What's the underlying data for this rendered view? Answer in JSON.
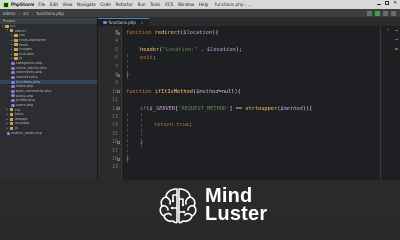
{
  "menubar": {
    "app_name": "PhpStorm",
    "items": [
      "File",
      "Edit",
      "View",
      "Navigate",
      "Code",
      "Refactor",
      "Run",
      "Tools",
      "VCS",
      "Window",
      "Help"
    ],
    "document_title": "functions.php - ..."
  },
  "toolbar": {
    "breadcrumbs": [
      "admin",
      "src",
      "functions.php"
    ]
  },
  "project": {
    "header": "Project",
    "tree": [
      {
        "label": "src",
        "kind": "folder",
        "depth": 0,
        "arrow": "▾"
      },
      {
        "label": "admin",
        "kind": "folder",
        "depth": 1,
        "arrow": "▾"
      },
      {
        "label": "css",
        "kind": "folder",
        "depth": 2,
        "arrow": "▸"
      },
      {
        "label": "fonts-awesome",
        "kind": "folder",
        "depth": 2,
        "arrow": "▸"
      },
      {
        "label": "fonts",
        "kind": "folder",
        "depth": 2,
        "arrow": "▸"
      },
      {
        "label": "images",
        "kind": "folder",
        "depth": 2,
        "arrow": "▸"
      },
      {
        "label": "includes",
        "kind": "folder",
        "depth": 2,
        "arrow": "▸"
      },
      {
        "label": "js",
        "kind": "folder",
        "depth": 2,
        "arrow": "▸"
      },
      {
        "label": "categories.php",
        "kind": "php",
        "depth": 2
      },
      {
        "label": "check_admin.php",
        "kind": "php",
        "depth": 2
      },
      {
        "label": "comments.php",
        "kind": "php",
        "depth": 2
      },
      {
        "label": "connect.php",
        "kind": "php",
        "depth": 2
      },
      {
        "label": "functions.php",
        "kind": "php",
        "depth": 2
      },
      {
        "label": "index.php",
        "kind": "php",
        "depth": 2
      },
      {
        "label": "post_comments.php",
        "kind": "php",
        "depth": 2
      },
      {
        "label": "posts.php",
        "kind": "php",
        "depth": 2
      },
      {
        "label": "profile.php",
        "kind": "php",
        "depth": 2
      },
      {
        "label": "users.php",
        "kind": "php",
        "depth": 2
      },
      {
        "label": "css",
        "kind": "folder",
        "depth": 1,
        "arrow": "▸"
      },
      {
        "label": "fonts",
        "kind": "folder",
        "depth": 1,
        "arrow": "▸"
      },
      {
        "label": "images",
        "kind": "folder",
        "depth": 1,
        "arrow": "▸"
      },
      {
        "label": "includes",
        "kind": "folder",
        "depth": 1,
        "arrow": "▸"
      },
      {
        "label": "js",
        "kind": "folder",
        "depth": 1,
        "arrow": "▸"
      },
      {
        "label": "author_posts.php",
        "kind": "php",
        "depth": 1
      }
    ]
  },
  "editor": {
    "tab_label": "functions.php",
    "lines": [
      {
        "n": "3",
        "segments": [
          [
            "kw",
            "function "
          ],
          [
            "fn",
            "redirect"
          ],
          [
            "",
            "("
          ],
          [
            "var",
            "$location"
          ],
          [
            "",
            ")"
          ],
          [
            "",
            "{"
          ]
        ],
        "indent": 0
      },
      {
        "n": "4",
        "segments": [],
        "indent": 0
      },
      {
        "n": "5",
        "segments": [
          [
            "fn",
            "header"
          ],
          [
            "",
            "("
          ],
          [
            "str",
            "\"Location:\""
          ],
          [
            "",
            " . "
          ],
          [
            "var",
            "$location"
          ],
          [
            "",
            ");"
          ]
        ],
        "indent": 1
      },
      {
        "n": "6",
        "segments": [
          [
            "kw",
            "exit"
          ],
          [
            "",
            ";"
          ]
        ],
        "indent": 1
      },
      {
        "n": "7",
        "segments": [],
        "indent": 0
      },
      {
        "n": "8",
        "segments": [
          [
            "",
            "}"
          ]
        ],
        "indent": 0
      },
      {
        "n": "9",
        "segments": [],
        "indent": 0
      },
      {
        "n": "10",
        "segments": [
          [
            "kw",
            "function "
          ],
          [
            "fn",
            "ifItIsMethod"
          ],
          [
            "",
            "("
          ],
          [
            "var",
            "$method"
          ],
          [
            "",
            "=null){"
          ]
        ],
        "indent": 0
      },
      {
        "n": "11",
        "segments": [],
        "indent": 0
      },
      {
        "n": "12",
        "segments": [
          [
            "kw",
            "if"
          ],
          [
            "",
            "("
          ],
          [
            "var",
            "$_SERVER"
          ],
          [
            "",
            "["
          ],
          [
            "str",
            "'REQUEST_METHOD'"
          ],
          [
            "",
            "] == "
          ],
          [
            "fn",
            "strtoupper"
          ],
          [
            "",
            "("
          ],
          [
            "var",
            "$method"
          ],
          [
            "",
            ")){"
          ]
        ],
        "indent": 1
      },
      {
        "n": "13",
        "segments": [],
        "indent": 0
      },
      {
        "n": "14",
        "segments": [
          [
            "kw",
            "return "
          ],
          [
            "kw",
            "true"
          ],
          [
            "",
            ";"
          ]
        ],
        "indent": 2
      },
      {
        "n": "15",
        "segments": [],
        "indent": 0
      },
      {
        "n": "16",
        "segments": [
          [
            "",
            "}"
          ]
        ],
        "indent": 1
      },
      {
        "n": "17",
        "segments": [],
        "indent": 0
      },
      {
        "n": "18",
        "segments": [
          [
            "",
            "}"
          ]
        ],
        "indent": 0
      },
      {
        "n": "19",
        "segments": [],
        "indent": 0
      }
    ]
  },
  "brand": {
    "line1": "Mind",
    "line2": "Luster"
  },
  "colors": {
    "keyword": "#cc7832",
    "variable": "#c9a0dc",
    "string": "#6a8759",
    "function": "#ffc66d",
    "brand_blue": "#4f9ed9"
  }
}
